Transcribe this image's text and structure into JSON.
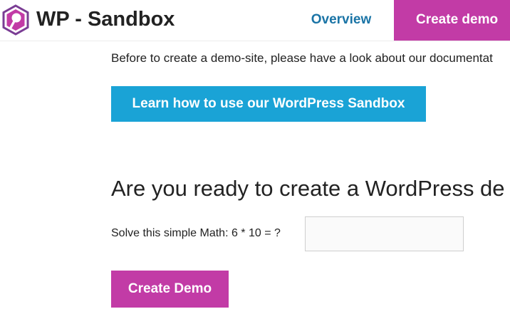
{
  "header": {
    "site_title": "WP - Sandbox",
    "logo_icon": "wordpress-hexagon-logo-icon",
    "nav": {
      "overview_label": "Overview",
      "create_demo_label": "Create demo"
    }
  },
  "main": {
    "intro_text": "Before to create a demo-site, please have a look about our documentat",
    "learn_button_label": "Learn how to use our WordPress Sandbox",
    "ready_heading": "Are you ready to create a WordPress de",
    "math_label": "Solve this simple Math: 6 * 10 = ?",
    "math_input_value": "",
    "create_button_label": "Create Demo"
  },
  "colors": {
    "brand_magenta": "#c23ba6",
    "link_blue": "#1a74a6",
    "button_blue": "#1aa3d6",
    "text": "#222222"
  }
}
